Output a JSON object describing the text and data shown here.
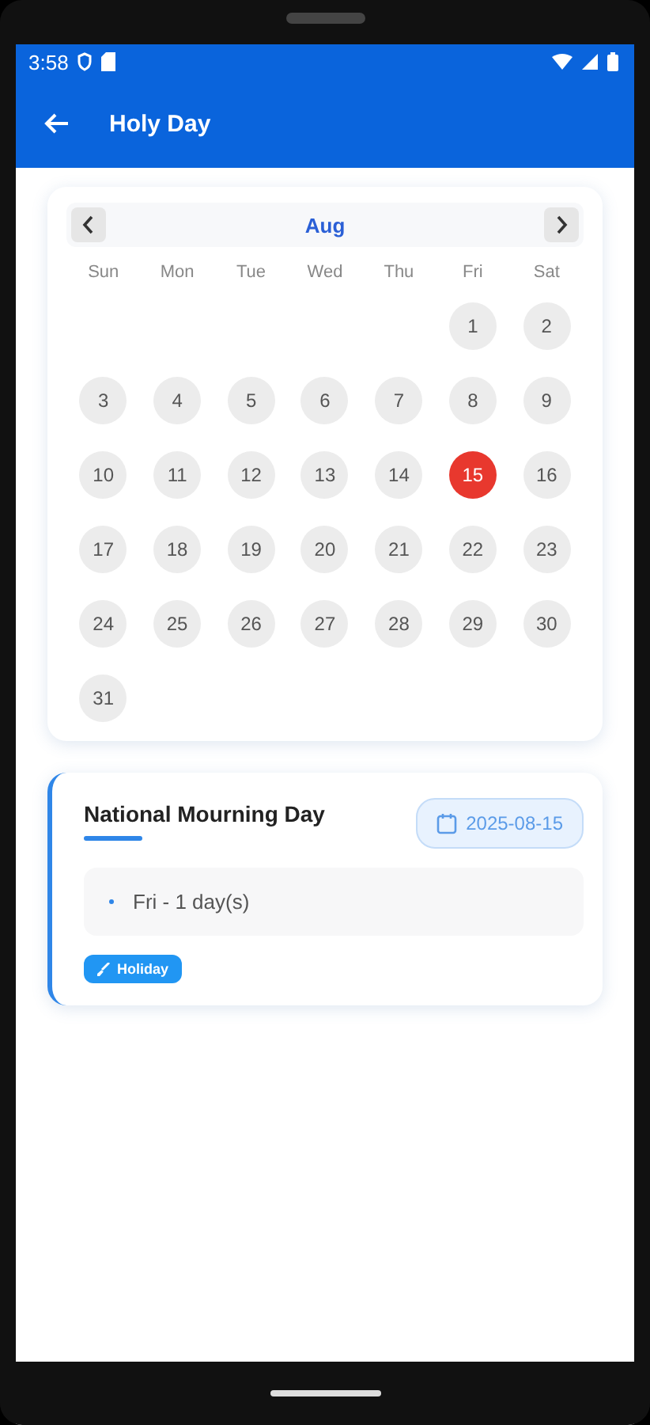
{
  "status_bar": {
    "time": "3:58"
  },
  "app_bar": {
    "title": "Holy Day"
  },
  "calendar": {
    "month": "Aug",
    "weekdays": [
      "Sun",
      "Mon",
      "Tue",
      "Wed",
      "Thu",
      "Fri",
      "Sat"
    ],
    "weeks": [
      [
        {
          "label": "1",
          "selected": false
        },
        {
          "label": "2",
          "selected": false
        }
      ],
      [
        {
          "label": "3",
          "selected": false
        },
        {
          "label": "4",
          "selected": false
        },
        {
          "label": "5",
          "selected": false
        },
        {
          "label": "6",
          "selected": false
        },
        {
          "label": "7",
          "selected": false
        },
        {
          "label": "8",
          "selected": false
        },
        {
          "label": "9",
          "selected": false
        }
      ],
      [
        {
          "label": "10",
          "selected": false
        },
        {
          "label": "11",
          "selected": false
        },
        {
          "label": "12",
          "selected": false
        },
        {
          "label": "13",
          "selected": false
        },
        {
          "label": "14",
          "selected": false
        },
        {
          "label": "15",
          "selected": true
        },
        {
          "label": "16",
          "selected": false
        }
      ],
      [
        {
          "label": "17",
          "selected": false
        },
        {
          "label": "18",
          "selected": false
        },
        {
          "label": "19",
          "selected": false
        },
        {
          "label": "20",
          "selected": false
        },
        {
          "label": "21",
          "selected": false
        },
        {
          "label": "22",
          "selected": false
        },
        {
          "label": "23",
          "selected": false
        }
      ],
      [
        {
          "label": "24",
          "selected": false
        },
        {
          "label": "25",
          "selected": false
        },
        {
          "label": "26",
          "selected": false
        },
        {
          "label": "27",
          "selected": false
        },
        {
          "label": "28",
          "selected": false
        },
        {
          "label": "29",
          "selected": false
        },
        {
          "label": "30",
          "selected": false
        }
      ],
      [
        {
          "label": "31",
          "selected": false
        }
      ]
    ]
  },
  "events": [
    {
      "title": "National Mourning Day",
      "date": "2025-08-15",
      "detail": "Fri - 1 day(s)",
      "tag": "Holiday"
    }
  ]
}
